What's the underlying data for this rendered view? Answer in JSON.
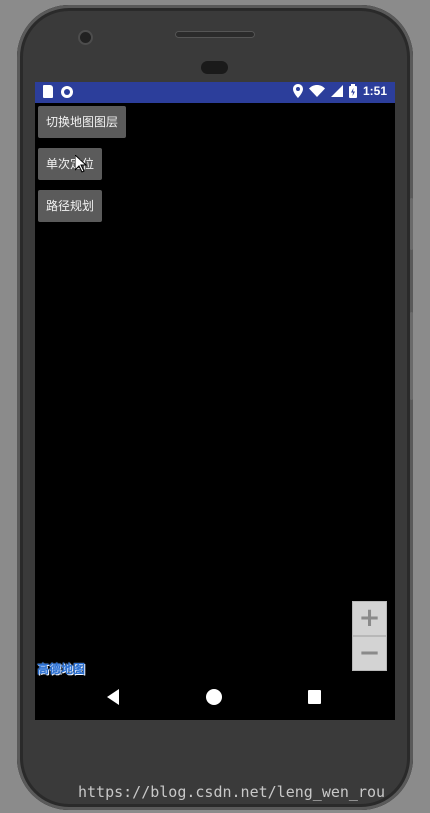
{
  "status_bar": {
    "time": "1:51",
    "icons": [
      "sd-card-icon",
      "sync-circle-icon",
      "location-pin-icon",
      "wifi-icon",
      "cell-signal-icon",
      "battery-icon"
    ],
    "color": "#2c3e9b"
  },
  "buttons": {
    "switch_layer": "切换地图图层",
    "single_location": "单次定位",
    "route_planning": "路径规划"
  },
  "zoom": {
    "in_label": "+",
    "out_label": "−"
  },
  "map_logo": "高德地图",
  "nav_bar": {
    "icons": [
      "back-icon",
      "home-icon",
      "recents-icon"
    ]
  },
  "watermark": "https://blog.csdn.net/leng_wen_rou"
}
